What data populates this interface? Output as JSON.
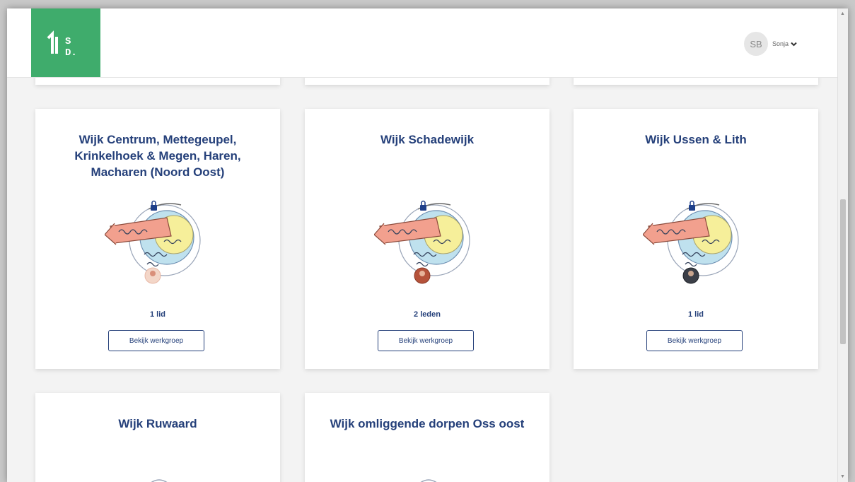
{
  "header": {
    "logo_text": "SD",
    "user": {
      "initials": "SB",
      "name": "Sonja"
    }
  },
  "cards": [
    {
      "title": "Wijk Centrum, Mettegeupel, Krinkelhoek & Megen, Haren, Macharen (Noord Oost)",
      "members": "1 lid",
      "button": "Bekijk werkgroep"
    },
    {
      "title": "Wijk Schadewijk",
      "members": "2 leden",
      "button": "Bekijk werkgroep"
    },
    {
      "title": "Wijk Ussen & Lith",
      "members": "1 lid",
      "button": "Bekijk werkgroep"
    },
    {
      "title": "Wijk Ruwaard"
    },
    {
      "title": "Wijk omliggende dorpen Oss oost"
    }
  ],
  "colors": {
    "brand_green": "#3fac6c",
    "title_blue": "#25407a"
  }
}
